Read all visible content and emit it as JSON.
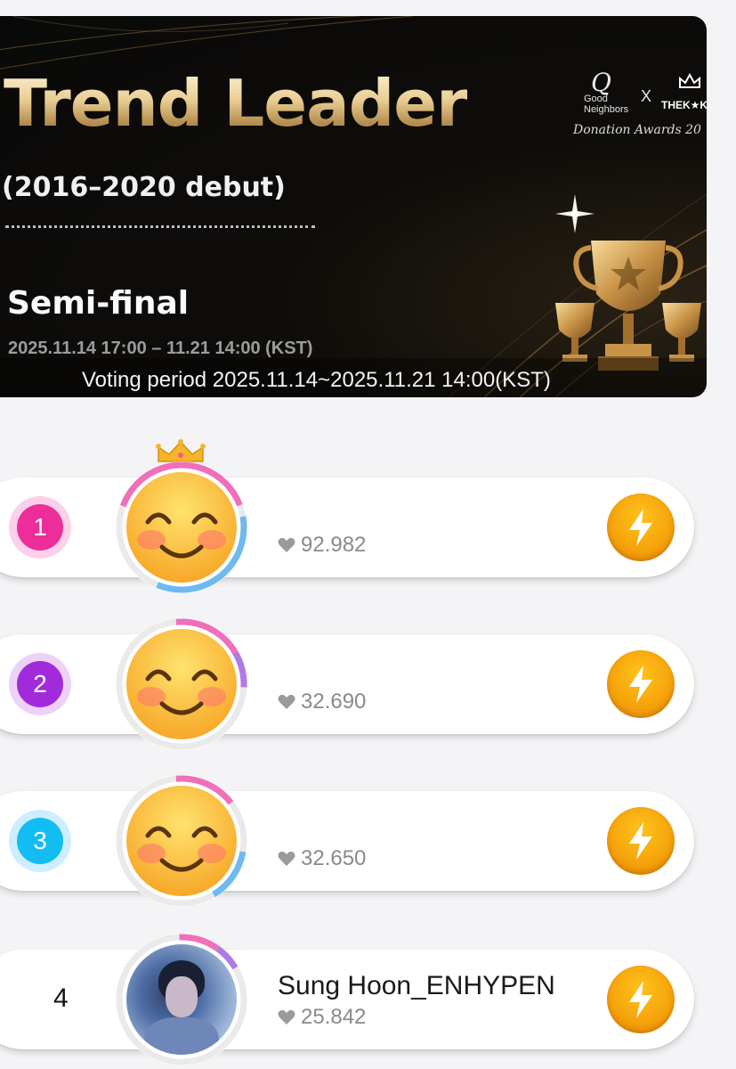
{
  "banner": {
    "title": "Trend Leader",
    "subtitle": "(2016–2020 debut)",
    "round": "Semi-final",
    "dates": "2025.11.14 17:00 – 11.21 14:00 (KST)",
    "voting_period": "Voting period 2025.11.14~2025.11.21 14:00(KST)",
    "partners": {
      "good_neighbors_mark": "Q",
      "good_neighbors_line1": "Good",
      "good_neighbors_line2": "Neighbors",
      "separator": "X",
      "thekking": "THEK★KI",
      "awards": "Donation Awards 20"
    }
  },
  "ranking": [
    {
      "rank": "1",
      "name": "",
      "votes": "92.982",
      "avatar": "smiling-face-emoji",
      "crown": true
    },
    {
      "rank": "2",
      "name": "",
      "votes": "32.690",
      "avatar": "smiling-face-emoji",
      "crown": false
    },
    {
      "rank": "3",
      "name": "",
      "votes": "32.650",
      "avatar": "smiling-face-emoji",
      "crown": false
    },
    {
      "rank": "4",
      "name": "Sung Hoon_ENHYPEN",
      "votes": "25.842",
      "avatar": "member-photo",
      "crown": false
    }
  ],
  "colors": {
    "rank1": "#ec2d9a",
    "rank2": "#a12bdb",
    "rank3": "#12bdf2",
    "vote_button": "#f5a20a",
    "banner_gold": "#e9cf95"
  }
}
